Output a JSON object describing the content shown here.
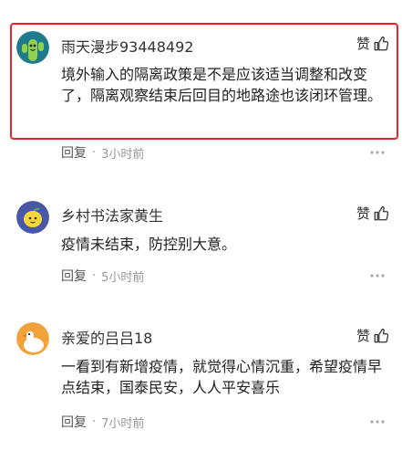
{
  "comments": [
    {
      "username": "雨天漫步93448492",
      "like_label": "赞",
      "text": "境外输入的隔离政策是不是应该适当调整和改变了，隔离观察结束后回目的地路途也该闭环管理。",
      "reply_label": "回复",
      "separator": "·",
      "time": "3小时前",
      "highlighted": true
    },
    {
      "username": "乡村书法家黄生",
      "like_label": "赞",
      "text": "疫情未结束，防控别大意。",
      "reply_label": "回复",
      "separator": "·",
      "time": "5小时前",
      "highlighted": false
    },
    {
      "username": "亲爱的吕吕18",
      "like_label": "赞",
      "text": "一看到有新增疫情，就觉得心情沉重，希望疫情早点结束，国泰民安，人人平安喜乐",
      "reply_label": "回复",
      "separator": "·",
      "time": "7小时前",
      "highlighted": false
    }
  ],
  "icons": {
    "like": "thumbs-up-icon",
    "more": "more-dots-icon"
  },
  "colors": {
    "highlight_border": "#e0252b",
    "meta_text": "#999999"
  }
}
